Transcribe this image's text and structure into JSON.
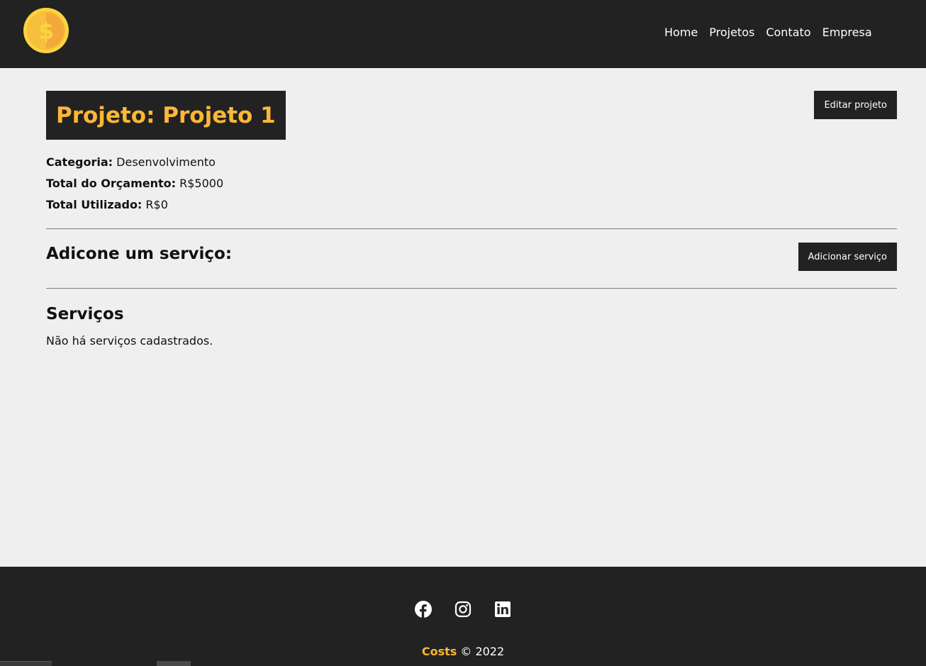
{
  "nav": {
    "links": [
      "Home",
      "Projetos",
      "Contato",
      "Empresa"
    ]
  },
  "project": {
    "title": "Projeto: Projeto 1",
    "edit_button": "Editar projeto",
    "category_label": "Categoria:",
    "category_value": "Desenvolvimento",
    "budget_label": "Total do Orçamento:",
    "budget_value": "R$5000",
    "used_label": "Total Utilizado:",
    "used_value": "R$0"
  },
  "service_form": {
    "heading": "Adicone um serviço:",
    "add_button": "Adicionar serviço"
  },
  "services": {
    "heading": "Serviços",
    "empty_message": "Não há serviços cadastrados."
  },
  "footer": {
    "social_icons": [
      "facebook-icon",
      "instagram-icon",
      "linkedin-icon"
    ],
    "brand": "Costs",
    "copyright": "© 2022"
  },
  "colors": {
    "dark": "#222222",
    "accent": "#fbb736",
    "background": "#efefef"
  }
}
